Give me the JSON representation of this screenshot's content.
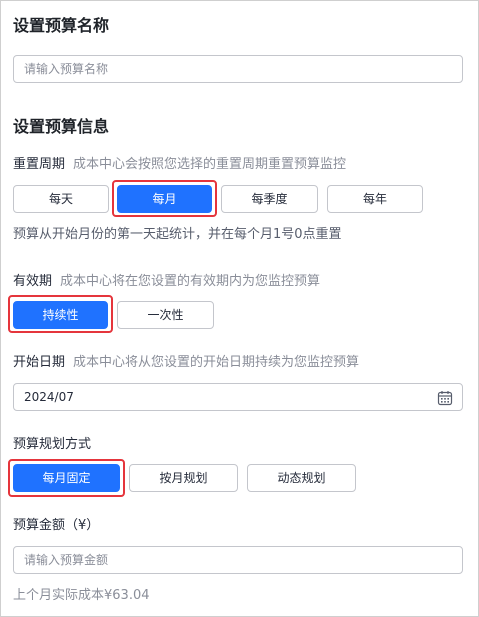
{
  "section_name": {
    "title": "设置预算名称",
    "input_placeholder": "请输入预算名称"
  },
  "section_info": {
    "title": "设置预算信息"
  },
  "reset_period": {
    "label": "重置周期",
    "hint": "成本中心会按照您选择的重置周期重置预算监控",
    "options": [
      "每天",
      "每月",
      "每季度",
      "每年"
    ],
    "selected": "每月",
    "note": "预算从开始月份的第一天起统计，并在每个月1号0点重置"
  },
  "validity": {
    "label": "有效期",
    "hint": "成本中心将在您设置的有效期内为您监控预算",
    "options": [
      "持续性",
      "一次性"
    ],
    "selected": "持续性"
  },
  "start_date": {
    "label": "开始日期",
    "hint": "成本中心将从您设置的开始日期持续为您监控预算",
    "value": "2024/07",
    "icon": "calendar-icon"
  },
  "planning_mode": {
    "label": "预算规划方式",
    "options": [
      "每月固定",
      "按月规划",
      "动态规划"
    ],
    "selected": "每月固定"
  },
  "amount": {
    "label": "预算金额（¥）",
    "input_placeholder": "请输入预算金额",
    "last_month_note": "上个月实际成本¥63.04"
  },
  "colors": {
    "accent": "#1f72ff",
    "highlight": "#e5353c"
  }
}
